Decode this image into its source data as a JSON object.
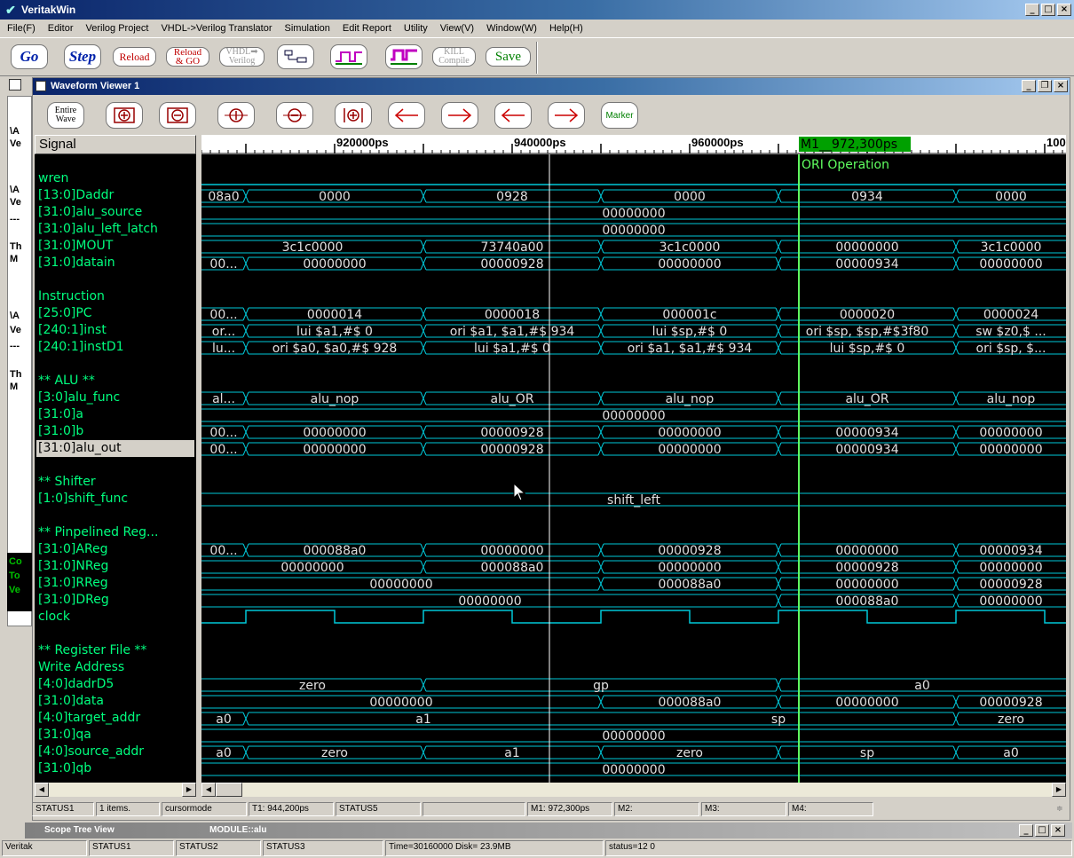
{
  "app": {
    "title": "VeritakWin",
    "menu": [
      "File(F)",
      "Editor",
      "Verilog Project",
      "VHDL->Verilog Translator",
      "Simulation",
      "Edit Report",
      "Utility",
      "View(V)",
      "Window(W)",
      "Help(H)"
    ]
  },
  "toolbar": {
    "go": "Go",
    "step": "Step",
    "reload": "Reload",
    "reload_go_1": "Reload",
    "reload_go_2": "& GO",
    "vhdl_1": "VHDL➡",
    "vhdl_2": "Verilog",
    "kill_1": "KILL",
    "kill_2": "Compile",
    "save": "Save"
  },
  "background_window": {
    "lines": [
      "\\A",
      "Ve",
      "\\A",
      "Ve",
      "---",
      "Th",
      "M",
      "\\A",
      "Ve",
      "---",
      "Th",
      "M"
    ],
    "console": [
      "Co",
      "To",
      "Ve"
    ]
  },
  "wave_viewer": {
    "title": "Waveform Viewer 1",
    "entire_wave_1": "Entire",
    "entire_wave_2": "Wave",
    "marker": "Marker",
    "signal_header": "Signal",
    "signals": [
      {
        "name": "wren",
        "row": 1
      },
      {
        "name": "[13:0]Daddr",
        "row": 2
      },
      {
        "name": "[31:0]alu_source",
        "row": 3
      },
      {
        "name": "[31:0]alu_left_latch",
        "row": 4
      },
      {
        "name": "[31:0]MOUT",
        "row": 5
      },
      {
        "name": "[31:0]datain",
        "row": 6
      },
      {
        "name": "Instruction",
        "row": 8
      },
      {
        "name": "[25:0]PC",
        "row": 9
      },
      {
        "name": "[240:1]inst",
        "row": 10
      },
      {
        "name": "[240:1]instD1",
        "row": 11
      },
      {
        "name": "** ALU **",
        "row": 13
      },
      {
        "name": "[3:0]alu_func",
        "row": 14
      },
      {
        "name": "[31:0]a",
        "row": 15
      },
      {
        "name": "[31:0]b",
        "row": 16
      },
      {
        "name": "[31:0]alu_out",
        "row": 17,
        "selected": true
      },
      {
        "name": "** Shifter",
        "row": 19
      },
      {
        "name": "[1:0]shift_func",
        "row": 20
      },
      {
        "name": "** Pinpelined Reg...",
        "row": 22
      },
      {
        "name": "[31:0]AReg",
        "row": 23
      },
      {
        "name": "[31:0]NReg",
        "row": 24
      },
      {
        "name": "[31:0]RReg",
        "row": 25
      },
      {
        "name": "[31:0]DReg",
        "row": 26
      },
      {
        "name": "clock",
        "row": 27
      },
      {
        "name": "** Register File **",
        "row": 29
      },
      {
        "name": " Write Address",
        "row": 30
      },
      {
        "name": "[4:0]dadrD5",
        "row": 31
      },
      {
        "name": "[31:0]data",
        "row": 32
      },
      {
        "name": "[4:0]target_addr",
        "row": 33
      },
      {
        "name": "[31:0]qa",
        "row": 34
      },
      {
        "name": "[4:0]source_addr",
        "row": 35
      },
      {
        "name": "[31:0]qb",
        "row": 36
      }
    ],
    "time_axis": {
      "unit": "ps",
      "start": 905000,
      "end": 1002400,
      "labels": [
        "920000ps",
        "940000ps",
        "960000ps",
        "100"
      ],
      "label_times": [
        920000,
        940000,
        960000,
        1000000
      ]
    },
    "marker_m1": {
      "label": "M1__972,300ps",
      "time": 972300,
      "annotation": "ORI Operation",
      "color": "#60ff60"
    },
    "cursor_t1": {
      "time": 944200
    },
    "clock": {
      "period": 20000,
      "first_rise": 910000,
      "duty": 0.5
    },
    "buses": [
      {
        "row": 2,
        "segs": [
          [
            null,
            910000,
            "08a0"
          ],
          [
            910000,
            930000,
            "0000"
          ],
          [
            930000,
            950000,
            "0928"
          ],
          [
            950000,
            970000,
            "0000"
          ],
          [
            970000,
            990000,
            "0934"
          ],
          [
            990000,
            null,
            "0000"
          ]
        ]
      },
      {
        "row": 3,
        "segs": [
          [
            null,
            null,
            "00000000"
          ]
        ]
      },
      {
        "row": 4,
        "segs": [
          [
            null,
            null,
            "00000000"
          ]
        ]
      },
      {
        "row": 5,
        "segs": [
          [
            null,
            930000,
            "3c1c0000"
          ],
          [
            930000,
            950000,
            "73740a00"
          ],
          [
            950000,
            970000,
            "3c1c0000"
          ],
          [
            970000,
            990000,
            "00000000"
          ],
          [
            990000,
            null,
            "3c1c0000"
          ]
        ]
      },
      {
        "row": 6,
        "segs": [
          [
            null,
            910000,
            "00..."
          ],
          [
            910000,
            930000,
            "00000000"
          ],
          [
            930000,
            950000,
            "00000928"
          ],
          [
            950000,
            970000,
            "00000000"
          ],
          [
            970000,
            990000,
            "00000934"
          ],
          [
            990000,
            null,
            "00000000"
          ]
        ]
      },
      {
        "row": 9,
        "segs": [
          [
            null,
            910000,
            "00..."
          ],
          [
            910000,
            930000,
            "0000014"
          ],
          [
            930000,
            950000,
            "0000018"
          ],
          [
            950000,
            970000,
            "000001c"
          ],
          [
            970000,
            990000,
            "0000020"
          ],
          [
            990000,
            null,
            "0000024"
          ]
        ]
      },
      {
        "row": 10,
        "segs": [
          [
            null,
            910000,
            "or..."
          ],
          [
            910000,
            930000,
            "lui  $a1,#$   0"
          ],
          [
            930000,
            950000,
            "ori  $a1, $a1,#$ 934"
          ],
          [
            950000,
            970000,
            "lui  $sp,#$   0"
          ],
          [
            970000,
            990000,
            "ori  $sp, $sp,#$3f80"
          ],
          [
            990000,
            null,
            "sw  $z0,$ ..."
          ]
        ]
      },
      {
        "row": 11,
        "segs": [
          [
            null,
            910000,
            "lu..."
          ],
          [
            910000,
            930000,
            "ori  $a0, $a0,#$ 928"
          ],
          [
            930000,
            950000,
            "lui  $a1,#$   0"
          ],
          [
            950000,
            970000,
            "ori  $a1, $a1,#$ 934"
          ],
          [
            970000,
            990000,
            "lui  $sp,#$   0"
          ],
          [
            990000,
            null,
            "ori  $sp, $..."
          ]
        ]
      },
      {
        "row": 14,
        "segs": [
          [
            null,
            910000,
            "al..."
          ],
          [
            910000,
            930000,
            "alu_nop"
          ],
          [
            930000,
            950000,
            "alu_OR"
          ],
          [
            950000,
            970000,
            "alu_nop"
          ],
          [
            970000,
            990000,
            "alu_OR"
          ],
          [
            990000,
            null,
            "alu_nop"
          ]
        ]
      },
      {
        "row": 15,
        "segs": [
          [
            null,
            null,
            "00000000"
          ]
        ]
      },
      {
        "row": 16,
        "segs": [
          [
            null,
            910000,
            "00..."
          ],
          [
            910000,
            930000,
            "00000000"
          ],
          [
            930000,
            950000,
            "00000928"
          ],
          [
            950000,
            970000,
            "00000000"
          ],
          [
            970000,
            990000,
            "00000934"
          ],
          [
            990000,
            null,
            "00000000"
          ]
        ]
      },
      {
        "row": 17,
        "segs": [
          [
            null,
            910000,
            "00..."
          ],
          [
            910000,
            930000,
            "00000000"
          ],
          [
            930000,
            950000,
            "00000928"
          ],
          [
            950000,
            970000,
            "00000000"
          ],
          [
            970000,
            990000,
            "00000934"
          ],
          [
            990000,
            null,
            "00000000"
          ]
        ]
      },
      {
        "row": 20,
        "segs": [
          [
            null,
            null,
            "shift_left"
          ]
        ]
      },
      {
        "row": 23,
        "segs": [
          [
            null,
            910000,
            "00..."
          ],
          [
            910000,
            930000,
            "000088a0"
          ],
          [
            930000,
            950000,
            "00000000"
          ],
          [
            950000,
            970000,
            "00000928"
          ],
          [
            970000,
            990000,
            "00000000"
          ],
          [
            990000,
            null,
            "00000934"
          ]
        ]
      },
      {
        "row": 24,
        "segs": [
          [
            null,
            930000,
            "00000000"
          ],
          [
            930000,
            950000,
            "000088a0"
          ],
          [
            950000,
            970000,
            "00000000"
          ],
          [
            970000,
            990000,
            "00000928"
          ],
          [
            990000,
            null,
            "00000000"
          ]
        ]
      },
      {
        "row": 25,
        "segs": [
          [
            null,
            950000,
            "00000000"
          ],
          [
            950000,
            970000,
            "000088a0"
          ],
          [
            970000,
            990000,
            "00000000"
          ],
          [
            990000,
            null,
            "00000928"
          ]
        ]
      },
      {
        "row": 26,
        "segs": [
          [
            null,
            970000,
            "00000000"
          ],
          [
            970000,
            990000,
            "000088a0"
          ],
          [
            990000,
            null,
            "00000000"
          ]
        ]
      },
      {
        "row": 31,
        "segs": [
          [
            null,
            930000,
            "zero"
          ],
          [
            930000,
            970000,
            "gp"
          ],
          [
            970000,
            null,
            "a0"
          ]
        ]
      },
      {
        "row": 32,
        "segs": [
          [
            null,
            950000,
            "00000000"
          ],
          [
            950000,
            970000,
            "000088a0"
          ],
          [
            970000,
            990000,
            "00000000"
          ],
          [
            990000,
            null,
            "00000928"
          ]
        ]
      },
      {
        "row": 33,
        "segs": [
          [
            null,
            910000,
            "a0"
          ],
          [
            910000,
            990000,
            "a1"
          ],
          [
            990000,
            null,
            "zero"
          ]
        ],
        "labels_override": [
          [
            910000,
            950000,
            "a1"
          ],
          [
            950000,
            990000,
            "sp"
          ]
        ]
      },
      {
        "row": 34,
        "segs": [
          [
            null,
            null,
            "00000000"
          ]
        ]
      },
      {
        "row": 35,
        "segs": [
          [
            null,
            910000,
            "a0"
          ],
          [
            910000,
            930000,
            "zero"
          ],
          [
            930000,
            950000,
            "a1"
          ],
          [
            950000,
            970000,
            "zero"
          ],
          [
            970000,
            990000,
            "sp"
          ],
          [
            990000,
            null,
            "a0"
          ]
        ]
      },
      {
        "row": 36,
        "segs": [
          [
            null,
            null,
            "00000000"
          ]
        ]
      }
    ],
    "colors": {
      "wave": "#00c8d8",
      "text": "#e0e0e0",
      "signal_text": "#00ff7f",
      "cursor": "#ffffff",
      "marker": "#60ff60"
    }
  },
  "wave_status": [
    "STATUS1",
    "1 items.",
    "cursormode",
    "T1: 944,200ps",
    "STATUS5",
    "",
    "M1: 972,300ps",
    "M2:",
    "M3:",
    "M4:"
  ],
  "scope": {
    "title": "Scope Tree View",
    "module": "MODULE::alu"
  },
  "main_status": [
    "Veritak",
    "STATUS1",
    "STATUS2",
    "STATUS3",
    "Time=30160000 Disk= 23.9MB",
    "status=12 0"
  ]
}
